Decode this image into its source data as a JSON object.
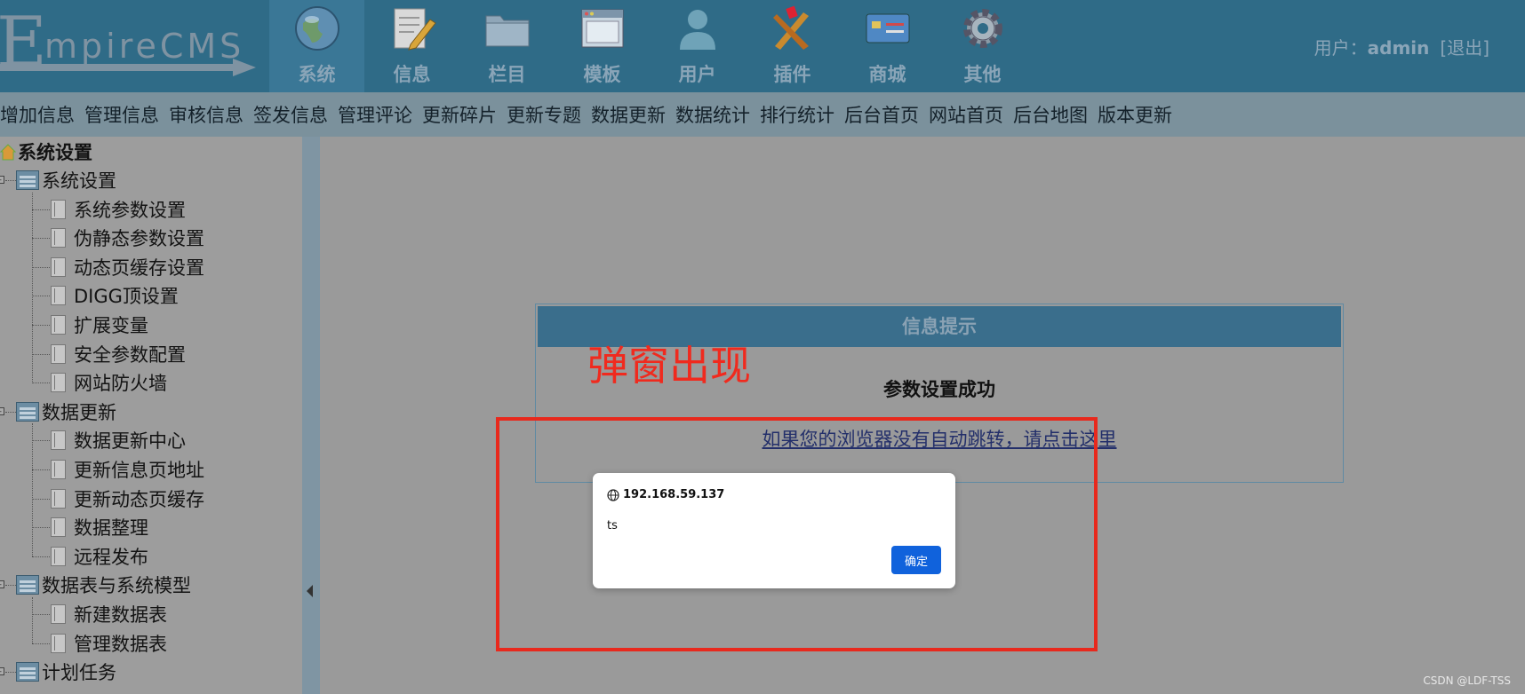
{
  "header": {
    "logo": "EmpireCMS",
    "nav": [
      {
        "label": "系统",
        "icon": "globe-icon",
        "active": true
      },
      {
        "label": "信息",
        "icon": "document-pencil-icon"
      },
      {
        "label": "栏目",
        "icon": "folder-icon"
      },
      {
        "label": "模板",
        "icon": "window-icon"
      },
      {
        "label": "用户",
        "icon": "user-icon"
      },
      {
        "label": "插件",
        "icon": "tools-icon"
      },
      {
        "label": "商城",
        "icon": "card-icon"
      },
      {
        "label": "其他",
        "icon": "gear-icon"
      }
    ],
    "user_prefix": "用户：",
    "username": "admin",
    "logout": "[退出]"
  },
  "subnav": [
    "增加信息",
    "管理信息",
    "审核信息",
    "签发信息",
    "管理评论",
    "更新碎片",
    "更新专题",
    "数据更新",
    "数据统计",
    "排行统计",
    "后台首页",
    "网站首页",
    "后台地图",
    "版本更新"
  ],
  "sidebar": {
    "root": "系统设置",
    "groups": [
      {
        "label": "系统设置",
        "items": [
          "系统参数设置",
          "伪静态参数设置",
          "动态页缓存设置",
          "DIGG顶设置",
          "扩展变量",
          "安全参数配置",
          "网站防火墙"
        ]
      },
      {
        "label": "数据更新",
        "items": [
          "数据更新中心",
          "更新信息页地址",
          "更新动态页缓存",
          "数据整理",
          "远程发布"
        ]
      },
      {
        "label": "数据表与系统模型",
        "items": [
          "新建数据表",
          "管理数据表"
        ]
      },
      {
        "label": "计划任务",
        "items": []
      }
    ]
  },
  "message": {
    "title": "信息提示",
    "text": "参数设置成功",
    "link": "如果您的浏览器没有自动跳转，请点击这里"
  },
  "annotation": "弹窗出现",
  "alert": {
    "origin": "192.168.59.137",
    "text": "ts",
    "ok": "确定"
  },
  "watermark": "CSDN @LDF-TSS",
  "colors": {
    "header_bg": "#2f6b87",
    "annotation_red": "#e8291d",
    "ok_button": "#1062dc"
  }
}
